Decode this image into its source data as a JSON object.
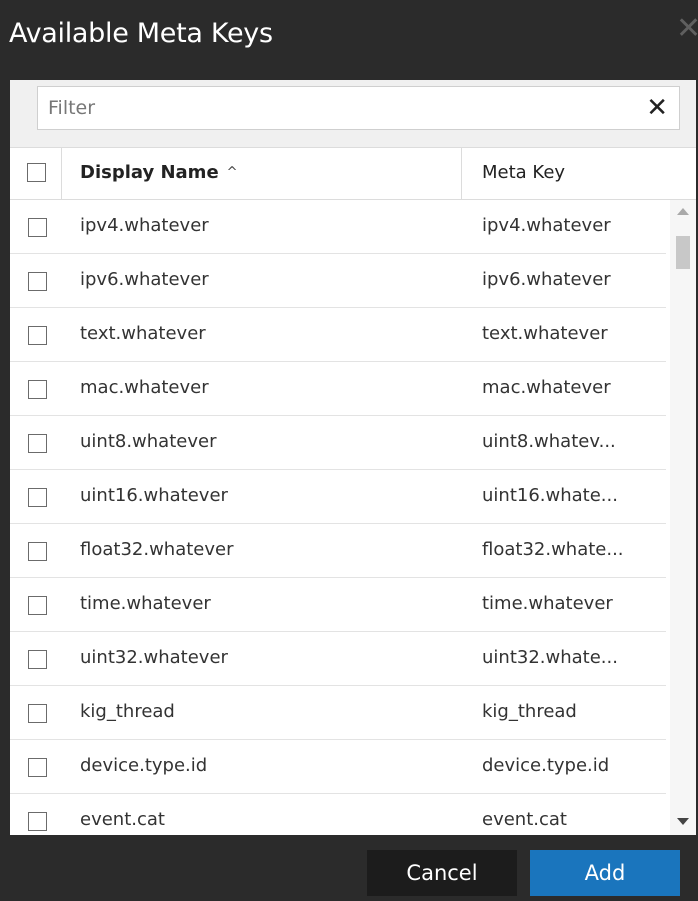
{
  "dialog": {
    "title": "Available Meta Keys",
    "close_glyph": "✕"
  },
  "filter": {
    "placeholder": "Filter",
    "value": "",
    "clear_glyph": "✕"
  },
  "table": {
    "columns": {
      "display_name": "Display Name",
      "sort_glyph": "^",
      "meta_key": "Meta Key"
    },
    "rows": [
      {
        "display_name": "ipv4.whatever",
        "meta_key": "ipv4.whatever"
      },
      {
        "display_name": "ipv6.whatever",
        "meta_key": "ipv6.whatever"
      },
      {
        "display_name": "text.whatever",
        "meta_key": "text.whatever"
      },
      {
        "display_name": "mac.whatever",
        "meta_key": "mac.whatever"
      },
      {
        "display_name": "uint8.whatever",
        "meta_key": "uint8.whatev..."
      },
      {
        "display_name": "uint16.whatever",
        "meta_key": "uint16.whate..."
      },
      {
        "display_name": "float32.whatever",
        "meta_key": "float32.whate..."
      },
      {
        "display_name": "time.whatever",
        "meta_key": "time.whatever"
      },
      {
        "display_name": "uint32.whatever",
        "meta_key": "uint32.whate..."
      },
      {
        "display_name": "kig_thread",
        "meta_key": "kig_thread"
      },
      {
        "display_name": "device.type.id",
        "meta_key": "device.type.id"
      },
      {
        "display_name": "event.cat",
        "meta_key": "event.cat"
      }
    ]
  },
  "footer": {
    "cancel_label": "Cancel",
    "add_label": "Add"
  },
  "colors": {
    "dialog_bg": "#2b2b2b",
    "primary_button": "#1a75bd",
    "secondary_button": "#1c1c1c"
  },
  "icons": [
    "close-icon",
    "clear-filter-icon",
    "sort-ascending-icon",
    "scroll-up-arrow-icon",
    "scroll-down-arrow-icon"
  ]
}
